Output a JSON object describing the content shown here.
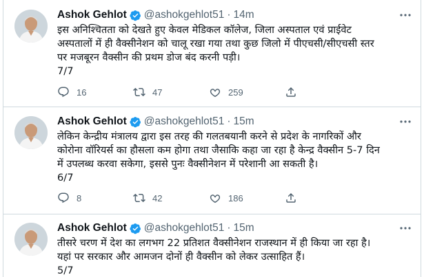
{
  "tweets": [
    {
      "name": "Ashok Gehlot",
      "handle": "@ashokgehlot51",
      "time": "14m",
      "lines": [
        "इस अनिश्चितता को देखते हुए केवल मेडिकल कॉलेज, जिला अस्पताल एवं प्राईवेट",
        "अस्पतालों में ही वैक्सीनेशन को चालू रखा गया तथा कुछ जिलो में पीएचसी/सीएचसी स्तर",
        "पर मजबूरन वैक्सीन की प्रथम डोज बंद करनी पड़ी।",
        "7/7"
      ],
      "replies": "16",
      "retweets": "47",
      "likes": "259"
    },
    {
      "name": "Ashok Gehlot",
      "handle": "@ashokgehlot51",
      "time": "15m",
      "lines": [
        "लेकिन केन्द्रीय मंत्रालय द्वारा इस तरह की गलतबयानी करने से प्रदेश के नागरिकों और",
        "कोरोना वॉरियर्स का हौसला कम होगा तथा जैसाकि कहा जा रहा है केन्द्र वैक्सीन 5-7 दिन",
        "में उपलब्ध करवा सकेगा, इससे पुनः वैक्सीनेशन में परेशानी आ सकती है।",
        "6/7"
      ],
      "replies": "8",
      "retweets": "42",
      "likes": "186"
    },
    {
      "name": "Ashok Gehlot",
      "handle": "@ashokgehlot51",
      "time": "15m",
      "lines": [
        "तीसरे चरण में देश का लगभग 22 प्रतिशत वैक्सीनेशन राजस्थान में ही किया जा रहा है।",
        "यहां पर सरकार और आमजन दोनों ही वैक्सीन को लेकर उत्साहित हैं।",
        "5/7"
      ]
    }
  ],
  "colors": {
    "verified": "#1d9bf0",
    "secondary_text": "#536471",
    "divider": "#cfd9de"
  },
  "icons": [
    "reply-icon",
    "retweet-icon",
    "like-icon",
    "share-icon",
    "verified-badge-icon",
    "more-icon"
  ]
}
